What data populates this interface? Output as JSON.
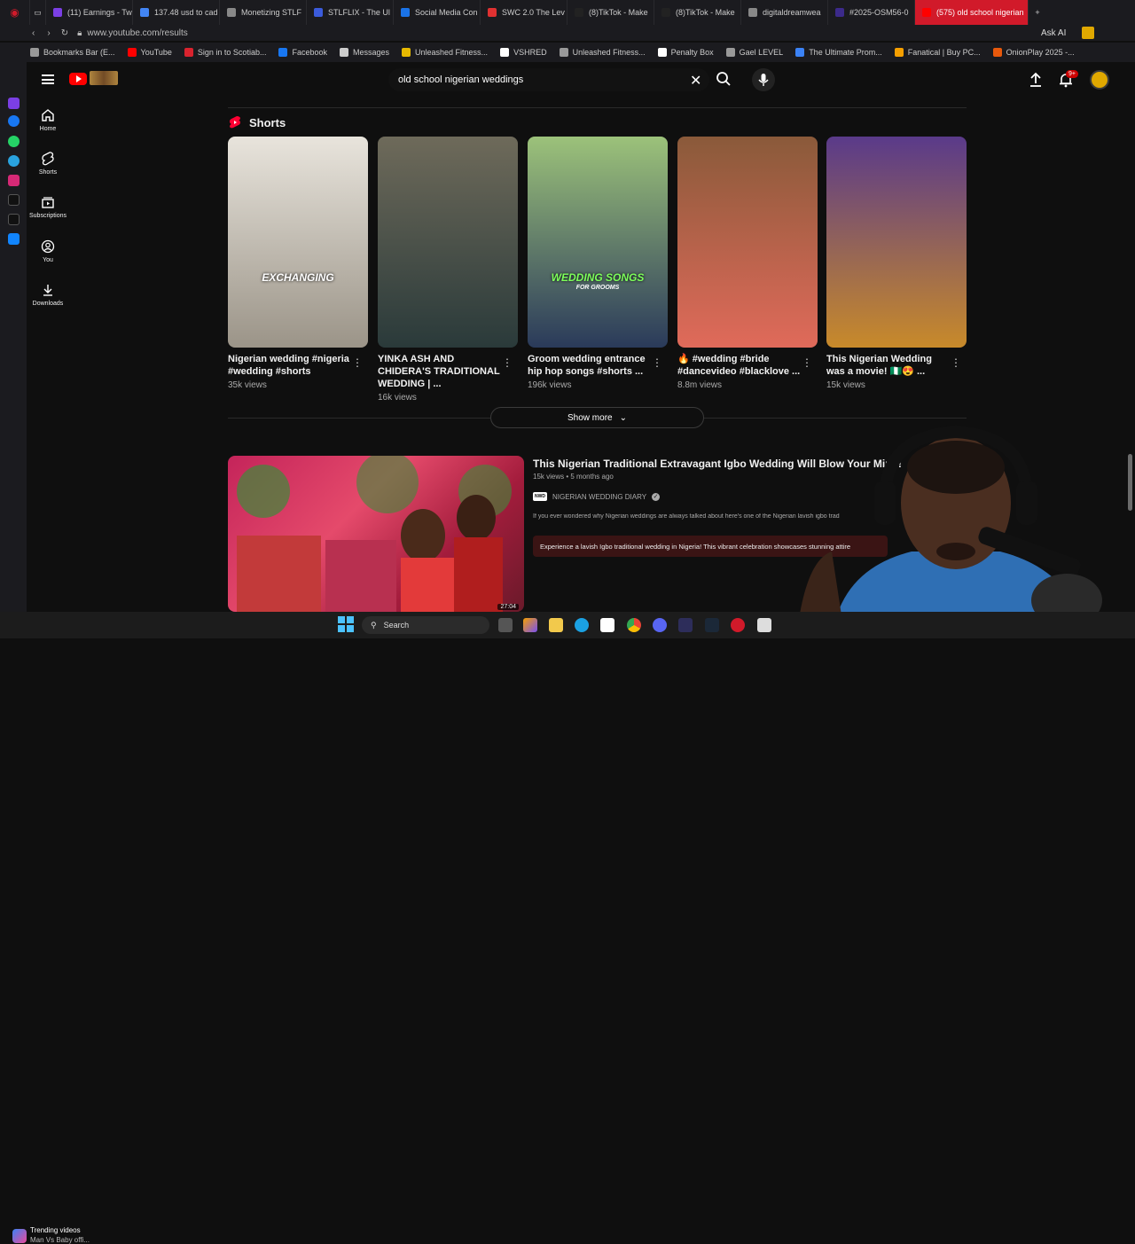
{
  "browser": {
    "tabs": [
      {
        "label": "(11) Earnings - Tw",
        "color": "#7b3fe4"
      },
      {
        "label": "137.48 usd to cad",
        "color": "#4285f4"
      },
      {
        "label": "Monetizing STLF",
        "color": "#888888"
      },
      {
        "label": "STLFLIX - The Ul",
        "color": "#3b5bdb"
      },
      {
        "label": "Social Media Con",
        "color": "#1a73e8"
      },
      {
        "label": "SWC 2.0 The Lev",
        "color": "#e03131"
      },
      {
        "label": "(8)TikTok - Make",
        "color": "#222222"
      },
      {
        "label": "(8)TikTok - Make",
        "color": "#222222"
      },
      {
        "label": "digitaldreamwea",
        "color": "#888888"
      },
      {
        "label": "#2025-OSM56-0",
        "color": "#3c2a8a"
      },
      {
        "label": "(575) old school nigerian",
        "color": "#ff0000",
        "active": true
      }
    ],
    "url": "www.youtube.com/results",
    "ask_ai": "Ask AI",
    "bookmarks": [
      {
        "label": "Bookmarks Bar (E...",
        "color": "#999999"
      },
      {
        "label": "YouTube",
        "color": "#ff0000"
      },
      {
        "label": "Sign in to Scotiab...",
        "color": "#d9232e"
      },
      {
        "label": "Facebook",
        "color": "#1877f2"
      },
      {
        "label": "Messages",
        "color": "#cccccc"
      },
      {
        "label": "Unleashed Fitness...",
        "color": "#e6b800"
      },
      {
        "label": "VSHRED",
        "color": "#ffffff"
      },
      {
        "label": "Unleashed Fitness...",
        "color": "#999999"
      },
      {
        "label": "Penalty Box",
        "color": "#ffffff"
      },
      {
        "label": "Gael LEVEL",
        "color": "#999999"
      },
      {
        "label": "The Ultimate Prom...",
        "color": "#3b82f6"
      },
      {
        "label": "Fanatical | Buy PC...",
        "color": "#f59f00"
      },
      {
        "label": "OnionPlay 2025 -...",
        "color": "#e8590c"
      }
    ]
  },
  "youtube": {
    "search_query": "old school nigerian weddings",
    "notif_badge": "9+",
    "nav": [
      {
        "label": "Home",
        "icon": "home-icon"
      },
      {
        "label": "Shorts",
        "icon": "shorts-icon"
      },
      {
        "label": "Subscriptions",
        "icon": "subscriptions-icon"
      },
      {
        "label": "You",
        "icon": "you-icon"
      },
      {
        "label": "Downloads",
        "icon": "downloads-icon"
      }
    ],
    "shorts_heading": "Shorts",
    "shorts": [
      {
        "title": "Nigerian wedding #nigeria #wedding #shorts",
        "views": "35k views",
        "overlay": "EXCHANGING",
        "colors": [
          "#e8e4dc",
          "#9b9488"
        ]
      },
      {
        "title": "YINKA ASH AND CHIDERA'S TRADITIONAL WEDDING | ...",
        "views": "16k views",
        "overlay": "",
        "colors": [
          "#6e6a5a",
          "#2a3a3a"
        ]
      },
      {
        "title": "Groom wedding entrance hip hop songs #shorts ...",
        "views": "196k views",
        "overlay": "WEDDING SONGS",
        "overlay_sub": "FOR GROOMS",
        "colors": [
          "#9cc27a",
          "#2a3a5a"
        ]
      },
      {
        "title": "🔥 #wedding #bride #dancevideo #blacklove ...",
        "views": "8.8m views",
        "overlay": "",
        "colors": [
          "#8a5a3a",
          "#e06a5a"
        ]
      },
      {
        "title": "This Nigerian Wedding was a movie! 🇳🇬😍 ...",
        "views": "15k views",
        "overlay": "",
        "colors": [
          "#5a3a8a",
          "#c88a2a"
        ]
      }
    ],
    "show_more": "Show more",
    "video": {
      "title": "This Nigerian Traditional Extravagant Igbo Wedding Will Blow Your Mind! Fu",
      "meta": "15k views • 5 months ago",
      "channel": "NIGERIAN WEDDING DIARY",
      "description": "If you ever wondered why Nigerian weddings are always talked about here's one of the Nigerian lavish igbo trad",
      "chapter_text": "Experience a lavish Igbo traditional wedding in Nigeria! This vibrant celebration showcases stunning attire",
      "duration": "27:04"
    }
  },
  "taskbar": {
    "trending_title": "Trending videos",
    "trending_sub": "Man Vs Baby offi...",
    "search_label": "Search"
  }
}
